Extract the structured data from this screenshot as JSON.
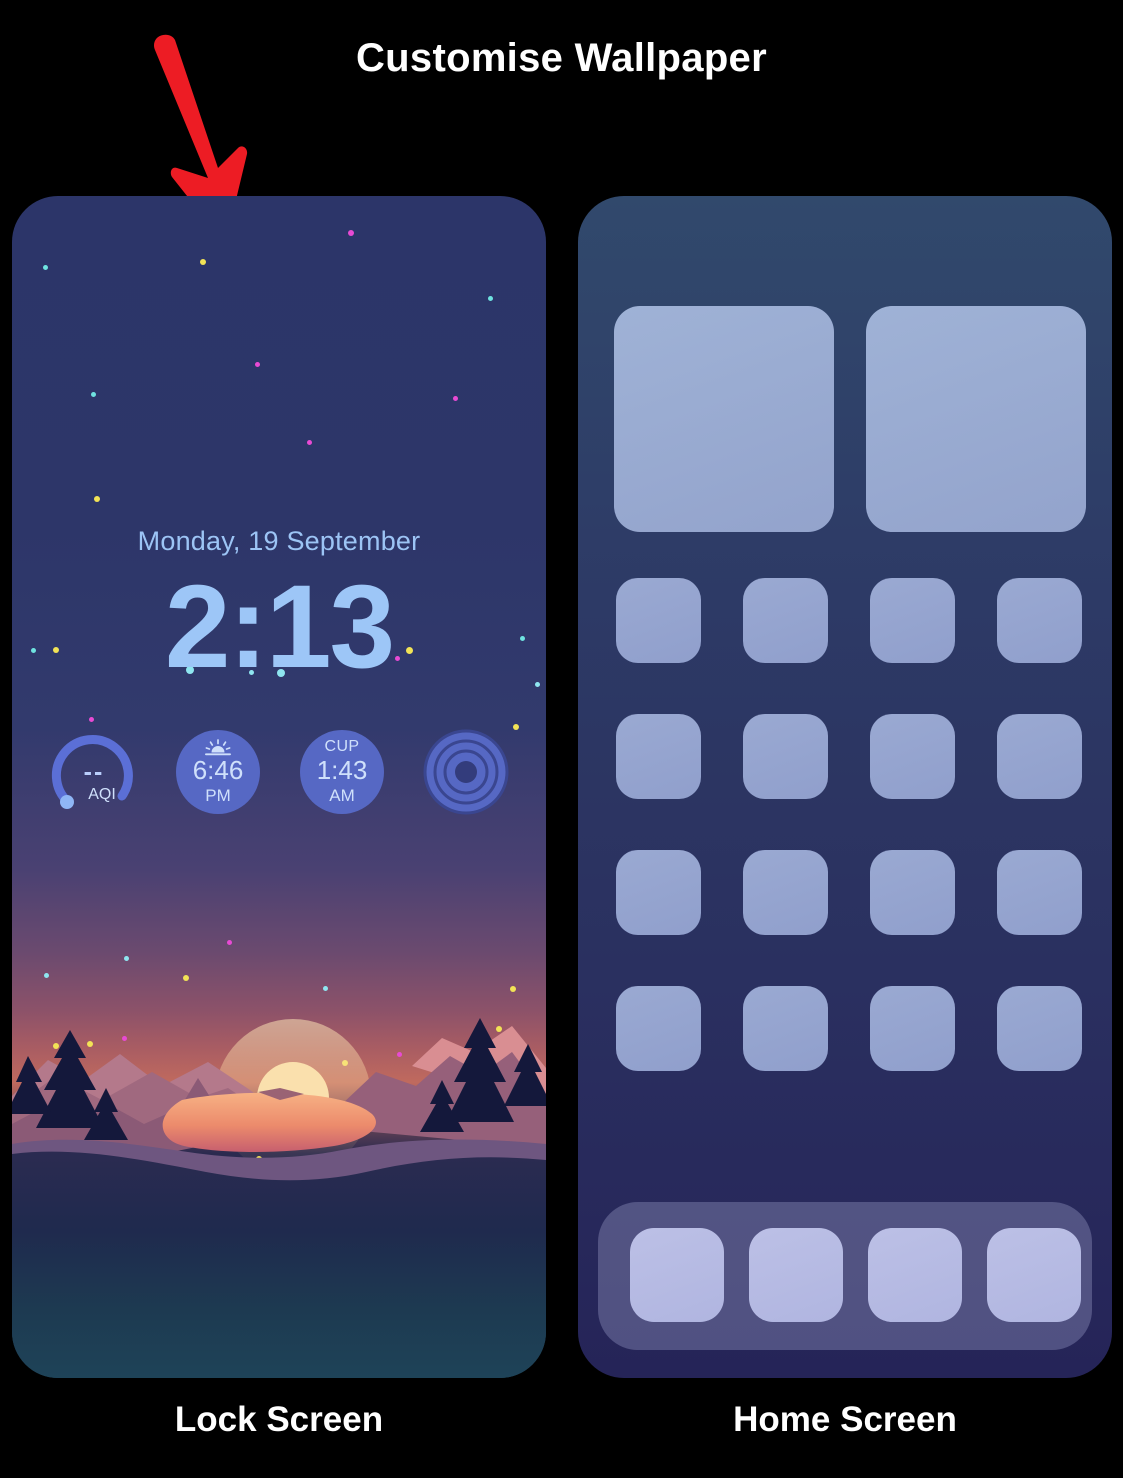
{
  "header": {
    "title": "Customise Wallpaper"
  },
  "annotation": {
    "arrow": "red-down-arrow",
    "color": "#ed1c24"
  },
  "lock_screen": {
    "caption": "Lock Screen",
    "date": "Monday, 19 September",
    "time": "2:13",
    "wallpaper": "sunset-mountain-lake-starry-sky",
    "widgets": [
      {
        "name": "air-quality",
        "icon": "gauge-icon",
        "value": "--",
        "label": "AQI"
      },
      {
        "name": "sunset",
        "icon": "sunset-icon",
        "top": "",
        "value": "6:46",
        "unit": "PM"
      },
      {
        "name": "world-clock",
        "icon": "",
        "top": "CUP",
        "value": "1:43",
        "unit": "AM"
      },
      {
        "name": "sleep-rings",
        "icon": "concentric-rings-icon",
        "top": "",
        "value": "",
        "unit": ""
      }
    ],
    "colors": {
      "sky_top": "#2c3569",
      "sky_bottom": "#1e4358",
      "text": "#9cc4f5",
      "widget_fill": "#5668c4"
    }
  },
  "home_screen": {
    "caption": "Home Screen",
    "widget_count": 2,
    "icon_rows": 4,
    "icons_per_row": 4,
    "dock_icon_count": 4,
    "colors": {
      "bg_top": "#31496c",
      "bg_bottom": "#252458",
      "icon": "#96a4cf",
      "dock": "#b6bae2"
    }
  }
}
